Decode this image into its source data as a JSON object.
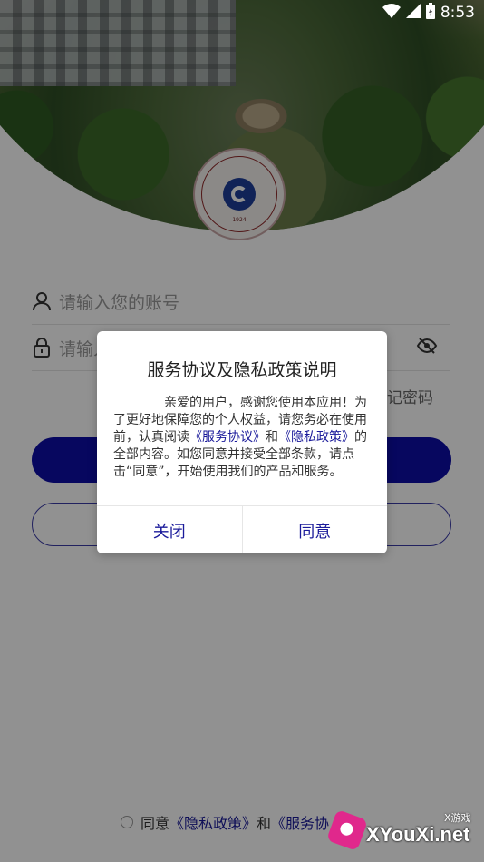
{
  "status_bar": {
    "time": "8:53"
  },
  "login": {
    "account_placeholder": "请输入您的账号",
    "password_placeholder": "请输入",
    "forgot_password": "忘记密码"
  },
  "agreement": {
    "prefix": "同意",
    "privacy_link": "《隐私政策》",
    "and": "和",
    "service_link": "《服务协"
  },
  "dialog": {
    "title": "服务协议及隐私政策说明",
    "body_part1": "亲爱的用户，感谢您使用本应用！为了更好地保障您的个人权益，请您务必在使用前，认真阅读",
    "service_link": "《服务协议》",
    "and": "和",
    "privacy_link": "《隐私政策》",
    "body_part2": "的全部内容。如您同意并接受全部条款，请点击“同意”，开始使用我们的产品和服务。",
    "close_label": "关闭",
    "agree_label": "同意"
  },
  "emblem": {
    "year": "1924"
  },
  "watermark": {
    "small": "X游戏",
    "main": "XYouXi.net"
  },
  "colors": {
    "primary": "#0d0da8",
    "link": "#1a1a9a",
    "overlay": "rgba(0,0,0,0.43)"
  }
}
